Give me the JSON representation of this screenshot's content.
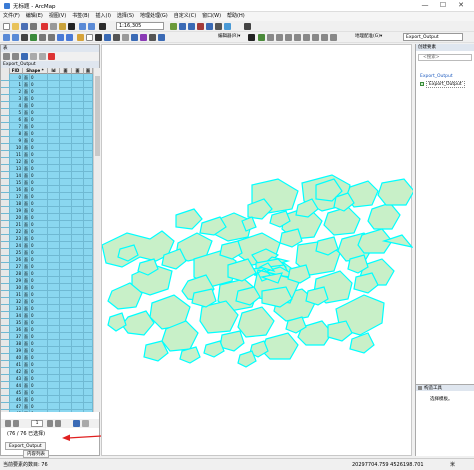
{
  "window": {
    "title": "无标题 - ArcMap",
    "minimize": "—",
    "maximize": "☐",
    "close": "✕"
  },
  "menu": [
    "文件(F)",
    "编辑(E)",
    "视图(V)",
    "书签(B)",
    "插入(I)",
    "选择(S)",
    "地理处理(G)",
    "自定义(C)",
    "窗口(W)",
    "帮助(H)"
  ],
  "toolbar": {
    "scale": "1:16,305",
    "editor_label": "编辑器(R)▾",
    "georef_label": "地理配准(G)▾",
    "georef_layer": "Export_Output"
  },
  "table": {
    "panel_label": "表",
    "name": "Export_Output",
    "columns": [
      "FID",
      "Shape *",
      "Id",
      "面",
      "面",
      "面"
    ],
    "rows": [
      {
        "fid": "0",
        "flag": "面",
        "shape": "0"
      },
      {
        "fid": "1",
        "flag": "面",
        "shape": "0"
      },
      {
        "fid": "2",
        "flag": "面",
        "shape": "0"
      },
      {
        "fid": "3",
        "flag": "面",
        "shape": "0"
      },
      {
        "fid": "4",
        "flag": "面",
        "shape": "0"
      },
      {
        "fid": "5",
        "flag": "面",
        "shape": "0"
      },
      {
        "fid": "6",
        "flag": "面",
        "shape": "0"
      },
      {
        "fid": "7",
        "flag": "面",
        "shape": "0"
      },
      {
        "fid": "8",
        "flag": "面",
        "shape": "0"
      },
      {
        "fid": "9",
        "flag": "面",
        "shape": "0"
      },
      {
        "fid": "10",
        "flag": "面",
        "shape": "0"
      },
      {
        "fid": "11",
        "flag": "面",
        "shape": "0"
      },
      {
        "fid": "12",
        "flag": "面",
        "shape": "0"
      },
      {
        "fid": "13",
        "flag": "面",
        "shape": "0"
      },
      {
        "fid": "14",
        "flag": "面",
        "shape": "0"
      },
      {
        "fid": "15",
        "flag": "面",
        "shape": "0"
      },
      {
        "fid": "16",
        "flag": "面",
        "shape": "0"
      },
      {
        "fid": "17",
        "flag": "面",
        "shape": "0"
      },
      {
        "fid": "18",
        "flag": "面",
        "shape": "0"
      },
      {
        "fid": "19",
        "flag": "面",
        "shape": "0"
      },
      {
        "fid": "20",
        "flag": "面",
        "shape": "0"
      },
      {
        "fid": "21",
        "flag": "面",
        "shape": "0"
      },
      {
        "fid": "22",
        "flag": "面",
        "shape": "0"
      },
      {
        "fid": "23",
        "flag": "面",
        "shape": "0"
      },
      {
        "fid": "24",
        "flag": "面",
        "shape": "0"
      },
      {
        "fid": "25",
        "flag": "面",
        "shape": "0"
      },
      {
        "fid": "26",
        "flag": "面",
        "shape": "0"
      },
      {
        "fid": "27",
        "flag": "面",
        "shape": "0"
      },
      {
        "fid": "28",
        "flag": "面",
        "shape": "0"
      },
      {
        "fid": "29",
        "flag": "面",
        "shape": "0"
      },
      {
        "fid": "30",
        "flag": "面",
        "shape": "0"
      },
      {
        "fid": "31",
        "flag": "面",
        "shape": "0"
      },
      {
        "fid": "32",
        "flag": "面",
        "shape": "0"
      },
      {
        "fid": "33",
        "flag": "面",
        "shape": "0"
      },
      {
        "fid": "34",
        "flag": "面",
        "shape": "0"
      },
      {
        "fid": "35",
        "flag": "面",
        "shape": "0"
      },
      {
        "fid": "36",
        "flag": "面",
        "shape": "0"
      },
      {
        "fid": "37",
        "flag": "面",
        "shape": "0"
      },
      {
        "fid": "38",
        "flag": "面",
        "shape": "0"
      },
      {
        "fid": "39",
        "flag": "面",
        "shape": "0"
      },
      {
        "fid": "40",
        "flag": "面",
        "shape": "0"
      },
      {
        "fid": "41",
        "flag": "面",
        "shape": "0"
      },
      {
        "fid": "42",
        "flag": "面",
        "shape": "0"
      },
      {
        "fid": "43",
        "flag": "面",
        "shape": "0"
      },
      {
        "fid": "44",
        "flag": "面",
        "shape": "0"
      },
      {
        "fid": "45",
        "flag": "面",
        "shape": "0"
      },
      {
        "fid": "46",
        "flag": "面",
        "shape": "0"
      },
      {
        "fid": "47",
        "flag": "面",
        "shape": "0"
      },
      {
        "fid": "48",
        "flag": "面",
        "shape": "0"
      }
    ],
    "nav_current": "1",
    "selection_status": "(76 / 76 已选择)",
    "bottom_tab": "Export_Output",
    "content_tab": "内容列表"
  },
  "right_panel": {
    "title": "创建要素",
    "search_placeholder": "<搜索>",
    "template_group": "Export_Output",
    "template_item": "Export_Output",
    "tools_title": "构造工具",
    "tools_hint": "选择模板。"
  },
  "statusbar": {
    "left": "当前要素的数目: 76",
    "coords": "20297704.759   4526198.701",
    "unit": "米"
  },
  "colors": {
    "selection_cyan": "#00ffff",
    "polygon_fill": "#c8f0c8",
    "grid_row": "#8ad7f0"
  }
}
